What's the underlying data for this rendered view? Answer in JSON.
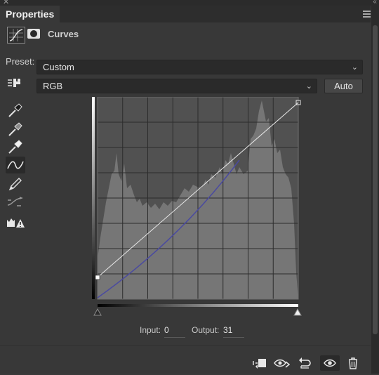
{
  "window": {
    "close_glyph": "✕",
    "collapse_glyph": "‹‹"
  },
  "panel": {
    "tab_title": "Properties"
  },
  "header": {
    "title": "Curves",
    "icons": [
      "curves-adjustment-icon",
      "layer-mask-icon"
    ]
  },
  "preset": {
    "label": "Preset:",
    "value": "Custom"
  },
  "channel": {
    "value": "RGB"
  },
  "auto_button": {
    "label": "Auto"
  },
  "tools": [
    "on-image-adjustment-icon",
    "black-point-eyedropper-icon",
    "gray-point-eyedropper-icon",
    "white-point-eyedropper-icon",
    "edit-points-curve-icon",
    "pencil-draw-icon",
    "smooth-curve-icon",
    "clipping-warning-icon"
  ],
  "input_output": {
    "input_label": "Input:",
    "input_value": "0",
    "output_label": "Output:",
    "output_value": "31"
  },
  "curve": {
    "points": [
      [
        0,
        31
      ],
      [
        255,
        255
      ]
    ],
    "selected_point": [
      0,
      31
    ],
    "composite_line_color": "#e8e8e8",
    "blue_channel_color": "#4a4aa0"
  },
  "bottom_bar": [
    "clip-to-layer-icon",
    "view-previous-state-icon",
    "reset-adjustments-icon",
    "toggle-visibility-icon",
    "delete-adjustment-icon"
  ],
  "colors": {
    "panel_bg": "#383838",
    "field_bg": "#2a2a2a",
    "histogram": "#767676",
    "graph_bg": "#515151"
  }
}
